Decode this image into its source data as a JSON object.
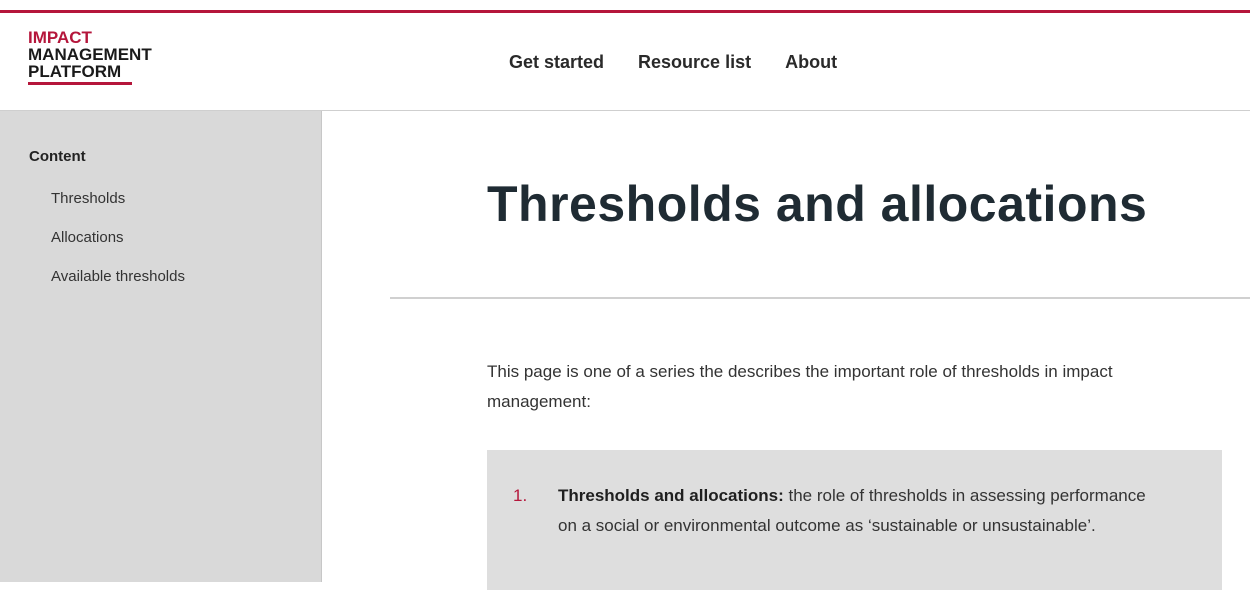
{
  "logo": {
    "line1": "IMPACT",
    "line2": "MANAGEMENT",
    "line3": "PLATFORM"
  },
  "nav": {
    "items": [
      "Get started",
      "Resource list",
      "About"
    ]
  },
  "sidebar": {
    "title": "Content",
    "items": [
      "Thresholds",
      "Allocations",
      "Available thresholds"
    ]
  },
  "main": {
    "title": "Thresholds and allocations",
    "intro": "This page is one of a series the describes the important role of thresholds in impact management:",
    "list": [
      {
        "number": "1.",
        "bold": "Thresholds and allocations:",
        "text": " the role of thresholds in assessing performance on a social or environmental outcome as ‘sustainable or unsustainable’."
      }
    ]
  },
  "colors": {
    "brand": "#b5163b",
    "sidebar_bg": "#d9d9d9",
    "callout_bg": "#dedede"
  }
}
